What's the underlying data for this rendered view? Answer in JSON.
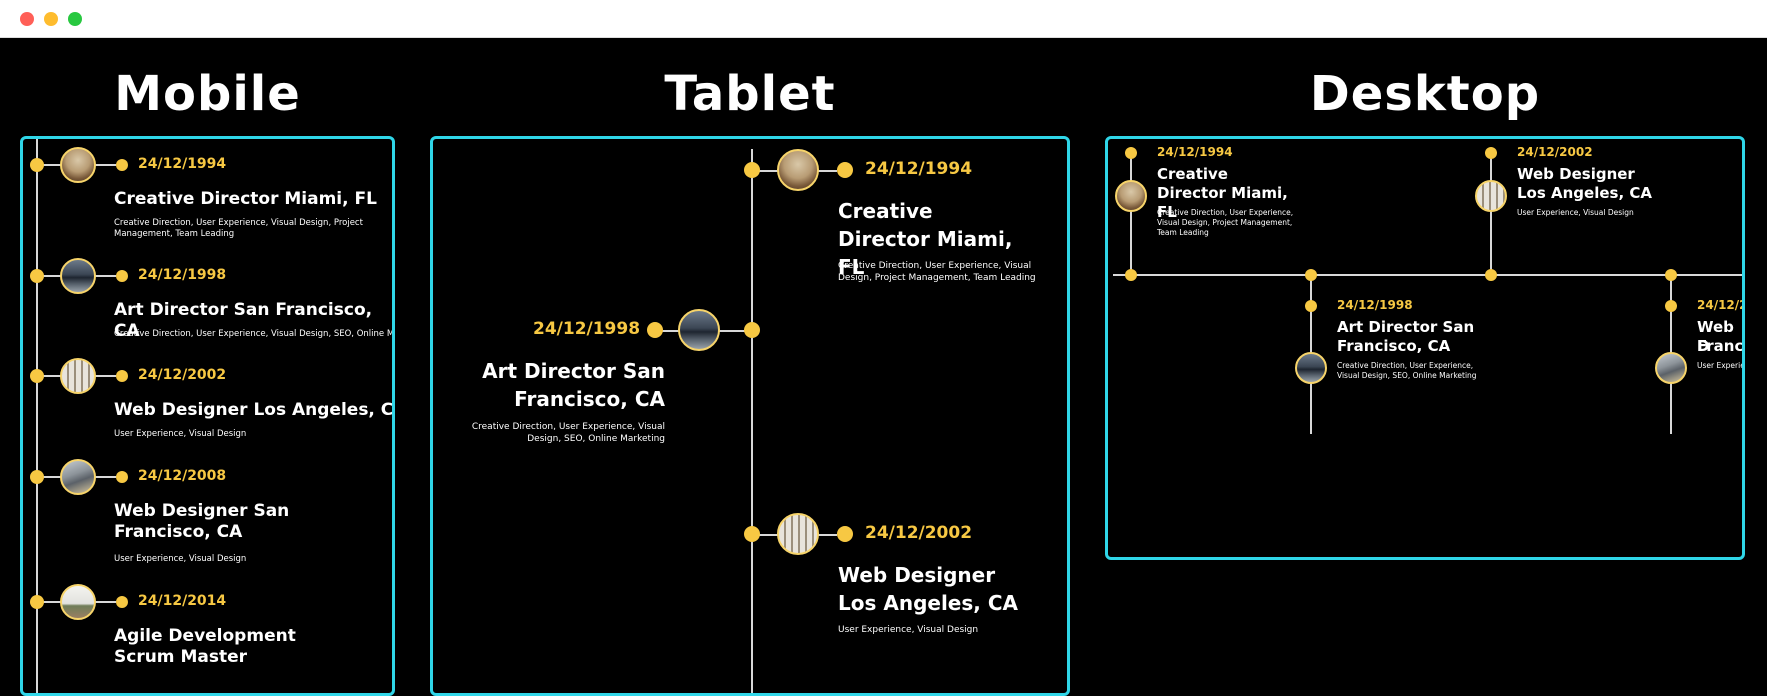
{
  "window": {
    "controls": [
      "close",
      "minimize",
      "zoom"
    ]
  },
  "colors": {
    "accent": "#f7c843",
    "panel_border": "#2fd6e8",
    "background": "#000000"
  },
  "sections": {
    "mobile": {
      "heading": "Mobile"
    },
    "tablet": {
      "heading": "Tablet"
    },
    "desktop": {
      "heading": "Desktop"
    }
  },
  "entries": [
    {
      "date": "24/12/1994",
      "title": "Creative Director Miami, FL",
      "description": "Creative Direction, User Experience, Visual Design, Project Management, Team Leading",
      "image": "sunset-photo"
    },
    {
      "date": "24/12/1998",
      "title": "Art Director San Francisco, CA",
      "description": "Creative Direction, User Experience, Visual Design, SEO, Online Marketing",
      "image": "car-photo"
    },
    {
      "date": "24/12/2002",
      "title": "Web Designer Los Angeles, CA",
      "description": "User Experience, Visual Design",
      "image": "building-photo"
    },
    {
      "date": "24/12/2008",
      "title": "Web Designer San Francisco, CA",
      "description": "User Experience, Visual Design",
      "image": "road-photo"
    },
    {
      "date": "24/12/2014",
      "title": "Agile Development Scrum Master",
      "description": "",
      "image": "sky-photo"
    }
  ],
  "desktop_partial": {
    "date": "24/12/2",
    "title_line1": "Web D",
    "title_line2": "Franc",
    "description": "User Experie"
  }
}
